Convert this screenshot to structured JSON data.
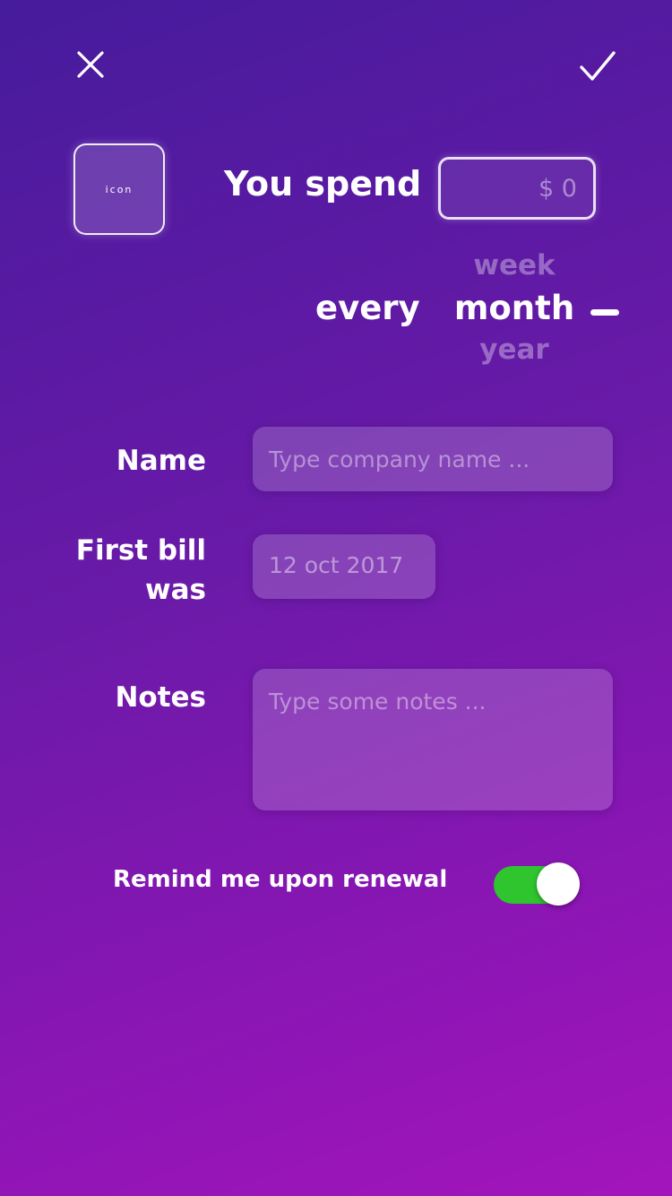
{
  "header": {
    "close_icon": "close-icon",
    "confirm_icon": "checkmark-icon"
  },
  "subscription": {
    "icon_placeholder": "icon",
    "spend_label": "You spend",
    "amount_placeholder": "$ 0",
    "every_label": "every",
    "periods": [
      "week",
      "month",
      "year"
    ],
    "selected_period": "month"
  },
  "form": {
    "name_label": "Name",
    "name_placeholder": "Type company name ...",
    "first_bill_label_line1": "First bill",
    "first_bill_label_line2": "was",
    "first_bill_value": "12 oct 2017",
    "notes_label": "Notes",
    "notes_placeholder": "Type some notes ..."
  },
  "reminder": {
    "label": "Remind me upon renewal",
    "enabled": true
  },
  "colors": {
    "toggle_on": "#2fc52f",
    "gradient_top": "#461b9c",
    "gradient_bottom": "#a315ba"
  }
}
